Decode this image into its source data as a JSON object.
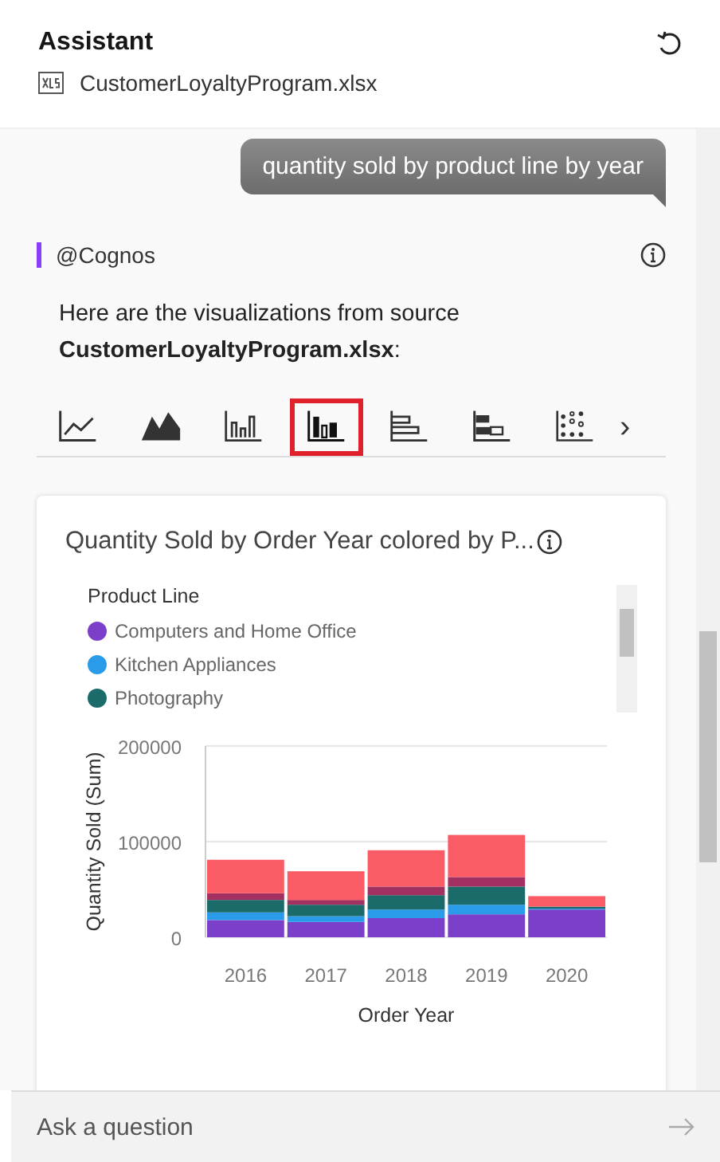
{
  "header": {
    "title": "Assistant",
    "file": "CustomerLoyaltyProgram.xlsx"
  },
  "conversation": {
    "user_message": "quantity sold by product line by year",
    "reply": {
      "sender": "@Cognos",
      "text": "Here are the visualizations from source **CustomerLoyaltyProgram.xlsx**:",
      "chart_types": [
        {
          "kind": "line",
          "selected": false
        },
        {
          "kind": "area",
          "selected": false
        },
        {
          "kind": "column",
          "selected": false
        },
        {
          "kind": "stacked-column",
          "selected": true
        },
        {
          "kind": "bar",
          "selected": false
        },
        {
          "kind": "stacked-bar",
          "selected": false
        },
        {
          "kind": "scatter",
          "selected": false
        }
      ],
      "more": "›",
      "card": {
        "title": "Quantity Sold by Order Year colored by P...",
        "legend": {
          "title": "Product Line"
        },
        "chart_data": {
          "type": "bar",
          "stacked": true,
          "xlabel": "Order Year",
          "ylabel": "Quantity Sold (Sum)",
          "categories": [
            "2016",
            "2017",
            "2018",
            "2019",
            "2020"
          ],
          "series": [
            {
              "name": "Computers and Home Office",
              "color": "#7b3fc9",
              "values": [
                18000,
                16000,
                20000,
                24000,
                29000
              ]
            },
            {
              "name": "Kitchen Appliances",
              "color": "#2a9be8",
              "values": [
                8000,
                6000,
                9000,
                10000,
                1000
              ]
            },
            {
              "name": "Photography",
              "color": "#1b6b6b",
              "values": [
                13000,
                12000,
                15000,
                19000,
                2000
              ]
            },
            {
              "color": "#a23060",
              "values": [
                7000,
                5000,
                9000,
                10000,
                0
              ]
            },
            {
              "color": "#fa5b64",
              "values": [
                35000,
                30000,
                38000,
                44000,
                11000
              ]
            }
          ],
          "ylim": [
            0,
            200000
          ],
          "yticks": [
            0,
            100000,
            200000
          ]
        }
      }
    }
  },
  "input": {
    "placeholder": "Ask a question"
  }
}
